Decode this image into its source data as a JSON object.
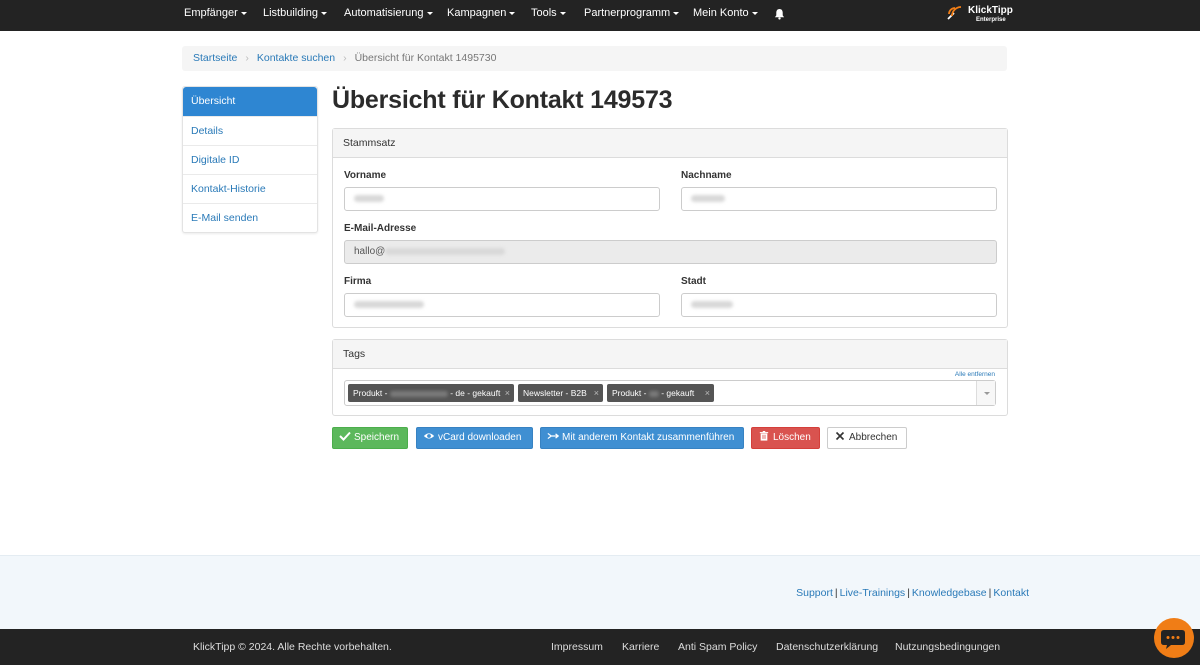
{
  "nav": {
    "items": [
      {
        "label": "Empfänger"
      },
      {
        "label": "Listbuilding"
      },
      {
        "label": "Automatisierung"
      },
      {
        "label": "Kampagnen"
      },
      {
        "label": "Tools"
      },
      {
        "label": "Partnerprogramm"
      },
      {
        "label": "Mein Konto"
      }
    ],
    "logo_title": "KlickTipp",
    "logo_sub": "Enterprise"
  },
  "breadcrumb": {
    "home": "Startseite",
    "search": "Kontakte suchen",
    "current": "Übersicht für Kontakt 1495730"
  },
  "sidebar": {
    "items": [
      {
        "label": "Übersicht"
      },
      {
        "label": "Details"
      },
      {
        "label": "Digitale ID"
      },
      {
        "label": "Kontakt-Historie"
      },
      {
        "label": "E-Mail senden"
      }
    ]
  },
  "page_title": "Übersicht für Kontakt 149573",
  "stammsatz": {
    "heading": "Stammsatz",
    "vorname_label": "Vorname",
    "nachname_label": "Nachname",
    "email_label": "E-Mail-Adresse",
    "email_value_prefix": "hallo@",
    "firma_label": "Firma",
    "stadt_label": "Stadt"
  },
  "tags": {
    "heading": "Tags",
    "remove_all": "Alle entfernen",
    "items": [
      {
        "prefix": "Produkt - ",
        "suffix": " - de - gekauft"
      },
      {
        "prefix": "Newsletter - B2B",
        "suffix": ""
      },
      {
        "prefix": "Produkt - ",
        "suffix": " - gekauft"
      }
    ]
  },
  "buttons": {
    "save": "Speichern",
    "vcard": "vCard downloaden",
    "merge": "Mit anderem Kontakt zusammenführen",
    "delete": "Löschen",
    "cancel": "Abbrechen"
  },
  "footer": {
    "links": {
      "support": "Support",
      "live_trainings": "Live-Trainings",
      "knowledgebase": "Knowledgebase",
      "kontakt": "Kontakt"
    },
    "copyright": "KlickTipp © 2024. Alle Rechte vorbehalten.",
    "bottom_links": {
      "impressum": "Impressum",
      "karriere": "Karriere",
      "anti_spam": "Anti Spam Policy",
      "datenschutz": "Datenschutzerklärung",
      "nutzung": "Nutzungsbedingungen"
    }
  },
  "colors": {
    "nav_bg": "#232323",
    "link": "#2a7ab8",
    "active": "#2e86d2",
    "save": "#5cb85c",
    "primary": "#3f8fd2",
    "danger": "#d9534f",
    "chat": "#f07d16"
  },
  "icons": {
    "bell": "bell-icon",
    "check": "check-icon",
    "eye": "eye-icon",
    "merge": "merge-arrows-icon",
    "trash": "trash-icon",
    "close": "close-icon",
    "chat": "chat-icon"
  }
}
